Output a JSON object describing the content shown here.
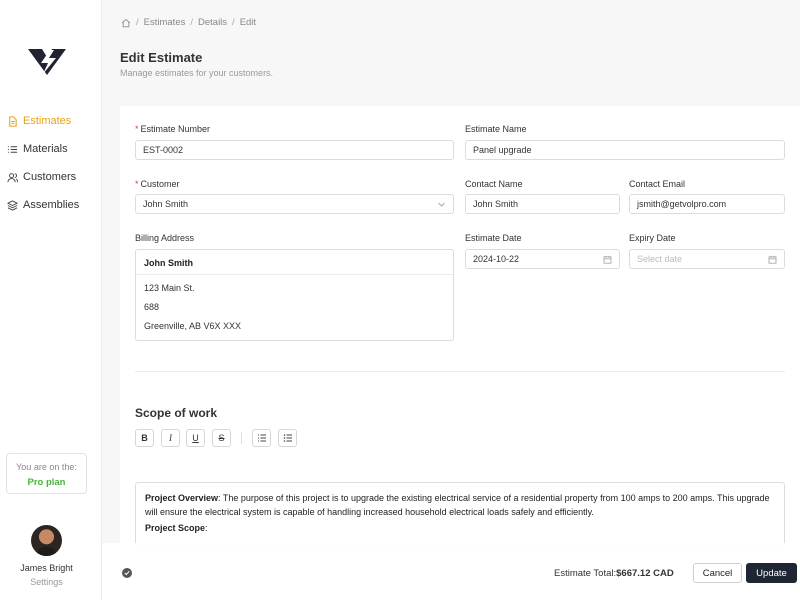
{
  "sidebar": {
    "items": [
      {
        "label": "Estimates",
        "icon": "document-icon"
      },
      {
        "label": "Materials",
        "icon": "list-icon"
      },
      {
        "label": "Customers",
        "icon": "users-icon"
      },
      {
        "label": "Assemblies",
        "icon": "layers-icon"
      }
    ],
    "active_color": "#e8a219",
    "plan": {
      "line1": "You are on the:",
      "line2": "Pro plan",
      "color": "#49b53b"
    },
    "user": {
      "name": "James Bright",
      "settings": "Settings"
    }
  },
  "breadcrumb": [
    "Estimates",
    "Details",
    "Edit"
  ],
  "page": {
    "title": "Edit Estimate",
    "subtitle": "Manage estimates for your customers."
  },
  "form": {
    "estimate_number": {
      "label": "Estimate Number",
      "value": "EST-0002"
    },
    "estimate_name": {
      "label": "Estimate Name",
      "value": "Panel upgrade"
    },
    "customer": {
      "label": "Customer",
      "value": "John Smith"
    },
    "contact_name": {
      "label": "Contact Name",
      "value": "John Smith"
    },
    "contact_email": {
      "label": "Contact Email",
      "value": "jsmith@getvolpro.com"
    },
    "billing_address": {
      "label": "Billing Address",
      "name": "John Smith",
      "line1": "123 Main St.",
      "line2": "688",
      "line3": "Greenville, AB V6X XXX"
    },
    "estimate_date": {
      "label": "Estimate Date",
      "value": "2024-10-22"
    },
    "expiry_date": {
      "label": "Expiry Date",
      "placeholder": "Select date"
    }
  },
  "scope": {
    "title": "Scope of work",
    "toolbar": {
      "bold": "B",
      "italic": "I",
      "underline": "U",
      "strike": "S"
    },
    "overview_label": "Project Overview",
    "overview_text": ": The purpose of this project is to upgrade the existing electrical service of a residential property from 100 amps to 200 amps. This upgrade will ensure the electrical system is capable of handling increased household electrical loads safely and efficiently.",
    "scope_label": "Project Scope",
    "scope_colon": ":"
  },
  "footer": {
    "total_label": "Estimate Total:",
    "total_value": "$667.12 CAD",
    "cancel": "Cancel",
    "update": "Update"
  }
}
